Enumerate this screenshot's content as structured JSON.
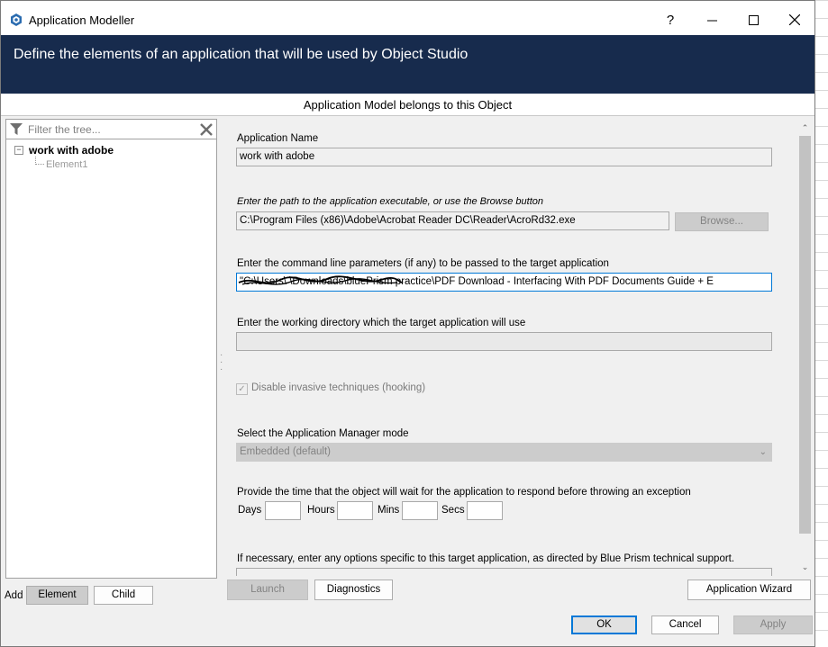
{
  "window": {
    "title": "Application Modeller",
    "help_label": "?",
    "minimize_label": "—",
    "maximize_label": "☐",
    "close_label": "✕"
  },
  "banner": {
    "text": "Define the elements of an application that will be used by Object Studio"
  },
  "subheading": "Application Model belongs to this Object",
  "tree": {
    "filter_placeholder": "Filter the tree...",
    "root_label": "work with adobe",
    "children": [
      "Element1"
    ]
  },
  "form": {
    "app_name_label": "Application Name",
    "app_name_value": "work with adobe",
    "exe_path_label": "Enter the path to the application executable, or use the Browse button",
    "exe_path_value": "C:\\Program Files (x86)\\Adobe\\Acrobat Reader DC\\Reader\\AcroRd32.exe",
    "browse_label": "Browse...",
    "cmd_params_label": "Enter the command line parameters (if any) to be passed to the target application",
    "cmd_params_value": "\"C:\\Users\\        \\Downloads\\bluePrism practice\\PDF Download - Interfacing With PDF Documents Guide + E",
    "workdir_label": "Enter the working directory which the target application will use",
    "workdir_value": "",
    "disable_invasive_label": "Disable invasive techniques (hooking)",
    "app_manager_mode_label": "Select the Application Manager mode",
    "app_manager_mode_value": "Embedded (default)",
    "timeout_label": "Provide the time that the object will wait for the application to respond before throwing an exception",
    "days_label": "Days",
    "hours_label": "Hours",
    "mins_label": "Mins",
    "secs_label": "Secs",
    "options_label": "If necessary, enter any options specific to this target application, as directed by Blue Prism technical support."
  },
  "bottom": {
    "add_label": "Add",
    "element_button": "Element",
    "child_button": "Child",
    "launch_button": "Launch",
    "diagnostics_button": "Diagnostics",
    "wizard_button": "Application Wizard",
    "ok_button": "OK",
    "cancel_button": "Cancel",
    "apply_button": "Apply"
  },
  "colors": {
    "banner_bg": "#172b4d",
    "accent": "#0078d7"
  }
}
